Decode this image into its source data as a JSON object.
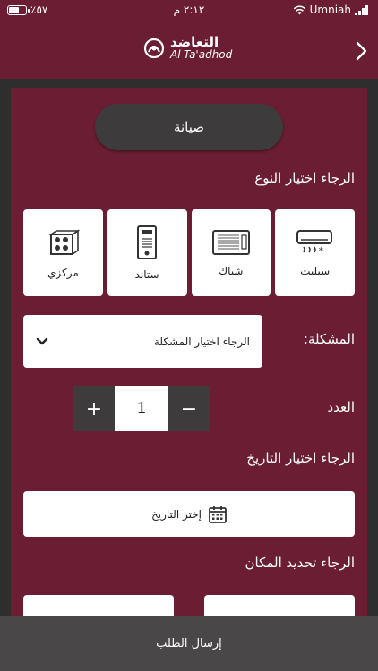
{
  "status_bar": {
    "carrier": "Umniah",
    "time": "٢:١٢ م",
    "battery_text": "٪٥٧"
  },
  "header": {
    "logo_arabic": "التعاضد",
    "logo_english": "Al-Ta'adhod"
  },
  "service": {
    "label": "صيانة"
  },
  "type_section": {
    "prompt": "الرجاء اختيار النوع",
    "types": [
      {
        "label": "سبليت",
        "icon": "split-ac-icon"
      },
      {
        "label": "شباك",
        "icon": "window-ac-icon"
      },
      {
        "label": "ستاند",
        "icon": "stand-ac-icon"
      },
      {
        "label": "مركزي",
        "icon": "central-ac-icon"
      }
    ]
  },
  "problem": {
    "label": "المشكلة:",
    "placeholder": "الرجاء اختيار المشكلة"
  },
  "count": {
    "label": "العدد",
    "value": "1",
    "plus": "+",
    "minus": "−"
  },
  "date": {
    "prompt": "الرجاء اختيار التاريخ",
    "button_label": "إختر التاريخ"
  },
  "location": {
    "prompt": "الرجاء تحديد المكان"
  },
  "submit": {
    "label": "إرسال الطلب"
  },
  "colors": {
    "background": "#6b1e33",
    "dark": "#3e3b3c",
    "card": "#ffffff"
  }
}
